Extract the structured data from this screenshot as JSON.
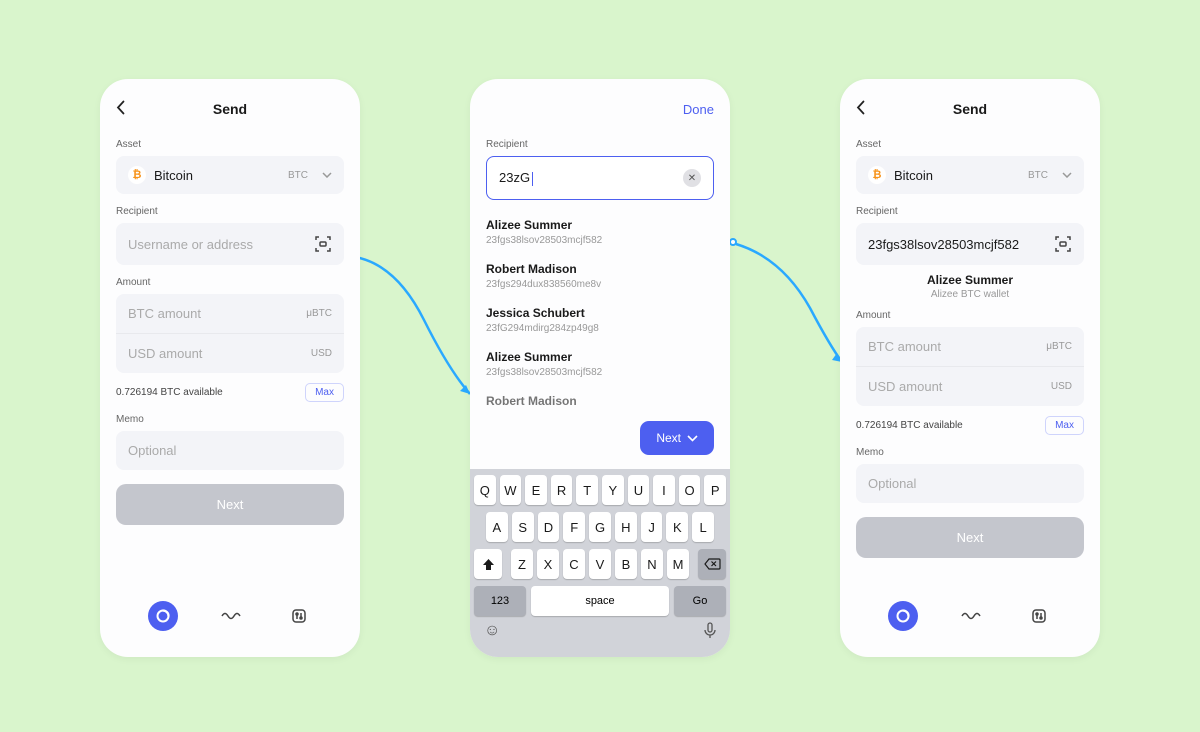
{
  "screen1": {
    "title": "Send",
    "asset_label": "Asset",
    "asset_name": "Bitcoin",
    "asset_ticker": "BTC",
    "recipient_label": "Recipient",
    "recipient_placeholder": "Username or address",
    "amount_label": "Amount",
    "btc_placeholder": "BTC amount",
    "btc_unit": "μBTC",
    "usd_placeholder": "USD amount",
    "usd_unit": "USD",
    "available": "0.726194 BTC available",
    "max": "Max",
    "memo_label": "Memo",
    "memo_placeholder": "Optional",
    "next": "Next"
  },
  "screen2": {
    "done": "Done",
    "recipient_label": "Recipient",
    "search_value": "23zG",
    "contacts": [
      {
        "name": "Alizee Summer",
        "addr": "23fgs38lsov28503mcjf582"
      },
      {
        "name": "Robert Madison",
        "addr": "23fgs294dux838560me8v"
      },
      {
        "name": "Jessica Schubert",
        "addr": "23fG294mdirg284zp49g8"
      },
      {
        "name": "Alizee Summer",
        "addr": "23fgs38lsov28503mcjf582"
      },
      {
        "name": "Robert Madison",
        "addr": ""
      }
    ],
    "next": "Next",
    "keyboard": {
      "row1": [
        "Q",
        "W",
        "E",
        "R",
        "T",
        "Y",
        "U",
        "I",
        "O",
        "P"
      ],
      "row2": [
        "A",
        "S",
        "D",
        "F",
        "G",
        "H",
        "J",
        "K",
        "L"
      ],
      "row3": [
        "Z",
        "X",
        "C",
        "V",
        "B",
        "N",
        "M"
      ],
      "k123": "123",
      "space": "space",
      "go": "Go"
    }
  },
  "screen3": {
    "title": "Send",
    "asset_label": "Asset",
    "asset_name": "Bitcoin",
    "asset_ticker": "BTC",
    "recipient_label": "Recipient",
    "recipient_value": "23fgs38lsov28503mcjf582",
    "recipient_name": "Alizee Summer",
    "recipient_sub": "Alizee BTC wallet",
    "amount_label": "Amount",
    "btc_placeholder": "BTC amount",
    "btc_unit": "μBTC",
    "usd_placeholder": "USD amount",
    "usd_unit": "USD",
    "available": "0.726194 BTC available",
    "max": "Max",
    "memo_label": "Memo",
    "memo_placeholder": "Optional",
    "next": "Next"
  }
}
